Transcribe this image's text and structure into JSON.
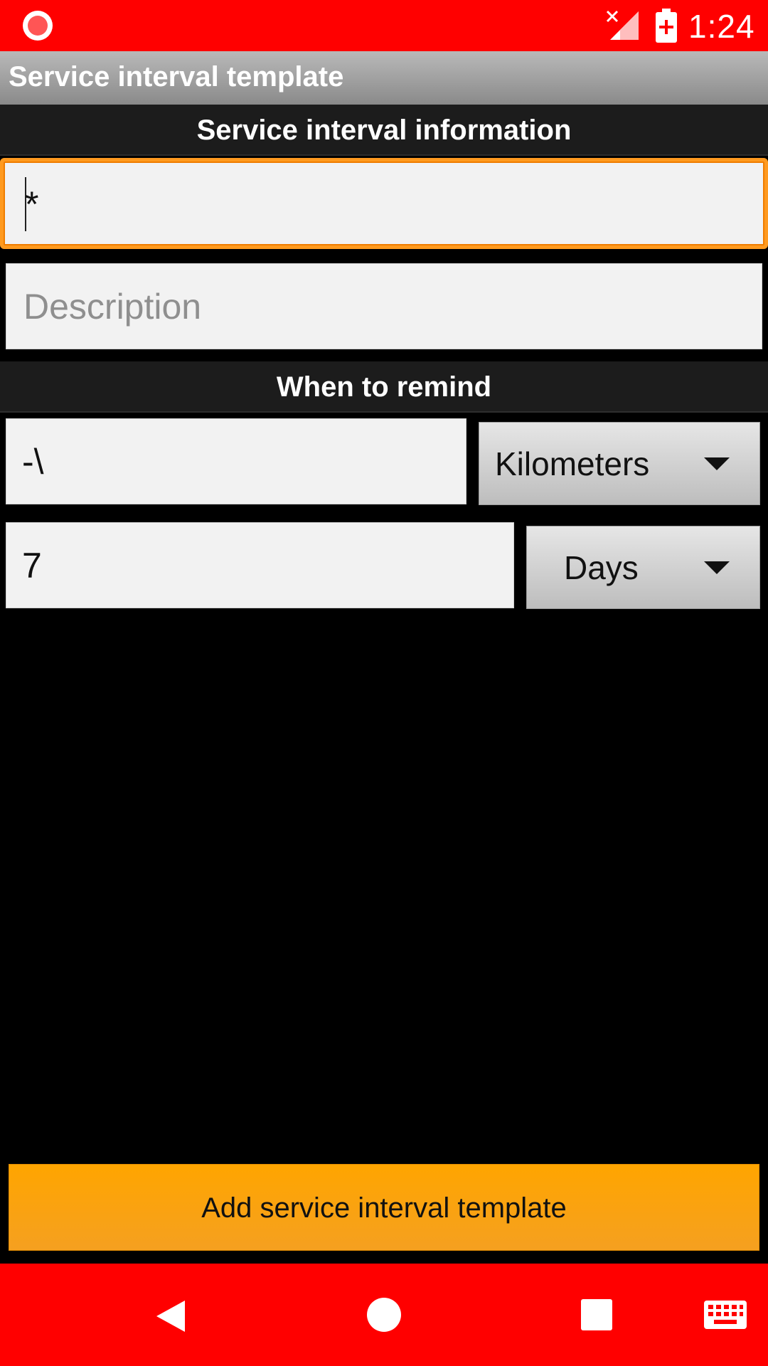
{
  "status_bar": {
    "time": "1:24",
    "icons": [
      "record-icon",
      "signal-off-icon",
      "battery-alert-icon"
    ],
    "background": "#ff0000"
  },
  "app_bar": {
    "title": "Service interval template"
  },
  "sections": {
    "info_header": "Service interval information",
    "remind_header": "When to remind"
  },
  "fields": {
    "name": {
      "value": "*",
      "focused": true
    },
    "description": {
      "value": "",
      "placeholder": "Description"
    },
    "distance": {
      "value": "-\\"
    },
    "distance_unit": {
      "selected": "Kilometers"
    },
    "time": {
      "value": "7"
    },
    "time_unit": {
      "selected": "Days"
    }
  },
  "actions": {
    "add_label": "Add service interval template",
    "accent": "#ffa500"
  },
  "nav_bar": {
    "icons": [
      "back-icon",
      "home-icon",
      "recents-icon",
      "keyboard-icon"
    ]
  }
}
